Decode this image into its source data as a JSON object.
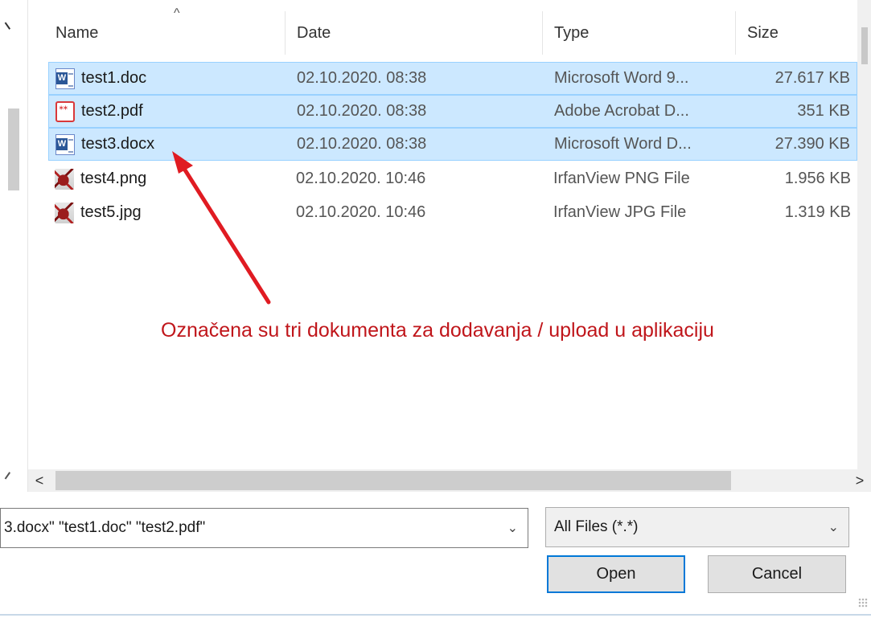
{
  "columns": {
    "name": "Name",
    "date": "Date",
    "type": "Type",
    "size": "Size"
  },
  "files": [
    {
      "name": "test1.doc",
      "date": "02.10.2020. 08:38",
      "type": "Microsoft Word 9...",
      "size": "27.617 KB",
      "icon": "word-doc-icon",
      "selected": true
    },
    {
      "name": "test2.pdf",
      "date": "02.10.2020. 08:38",
      "type": "Adobe Acrobat D...",
      "size": "351 KB",
      "icon": "pdf-icon",
      "selected": true
    },
    {
      "name": "test3.docx",
      "date": "02.10.2020. 08:38",
      "type": "Microsoft Word D...",
      "size": "27.390 KB",
      "icon": "word-docx-icon",
      "selected": true
    },
    {
      "name": "test4.png",
      "date": "02.10.2020. 10:46",
      "type": "IrfanView PNG File",
      "size": "1.956 KB",
      "icon": "irfanview-image-icon",
      "selected": false
    },
    {
      "name": "test5.jpg",
      "date": "02.10.2020. 10:46",
      "type": "IrfanView JPG File",
      "size": "1.319 KB",
      "icon": "irfanview-image-icon",
      "selected": false
    }
  ],
  "annotation": {
    "text": "Označena su tri dokumenta za dodavanja / upload u aplikaciju",
    "color": "#c0161b"
  },
  "filename_field": {
    "value": "3.docx\" \"test1.doc\" \"test2.pdf\""
  },
  "file_type_filter": {
    "selected": "All Files (*.*)"
  },
  "buttons": {
    "open": "Open",
    "cancel": "Cancel"
  },
  "colors": {
    "selection_bg": "#cce8ff",
    "selection_border": "#99d1ff",
    "accent": "#0078d7"
  }
}
